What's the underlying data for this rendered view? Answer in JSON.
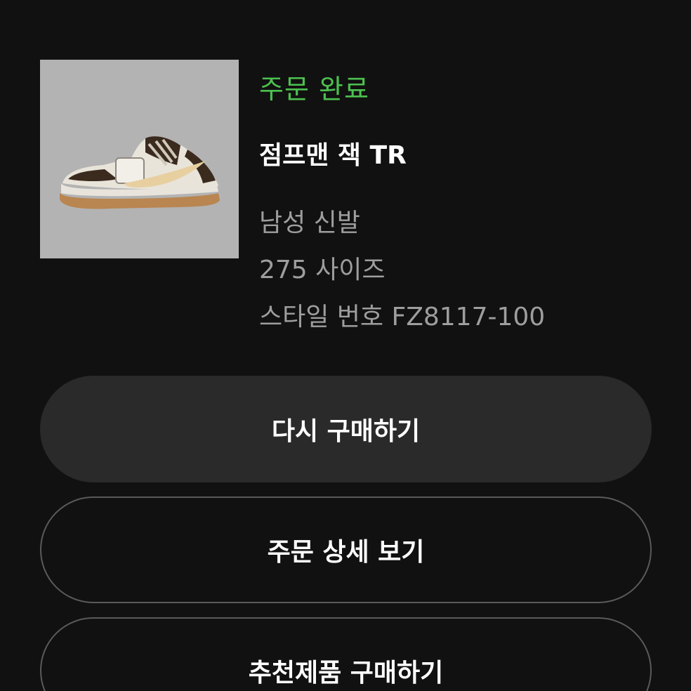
{
  "order": {
    "status": "주문 완료",
    "product_name": "점프맨 잭 TR",
    "category": "남성 신발",
    "size": "275 사이즈",
    "style": "스타일 번호 FZ8117-100",
    "status_color": "#4cc14f"
  },
  "actions": {
    "buy_again": "다시 구매하기",
    "order_detail": "주문 상세 보기",
    "buy_recommended": "추천제품 구매하기"
  },
  "image": {
    "icon": "sneaker-product-image"
  }
}
